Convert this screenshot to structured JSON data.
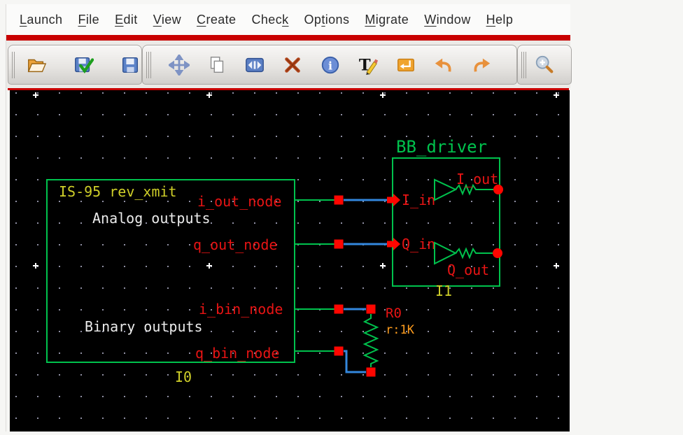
{
  "menubar": {
    "items": [
      {
        "label": "Launch",
        "underline": 0
      },
      {
        "label": "File",
        "underline": 0
      },
      {
        "label": "Edit",
        "underline": 0
      },
      {
        "label": "View",
        "underline": 0
      },
      {
        "label": "Create",
        "underline": 0
      },
      {
        "label": "Check",
        "underline": 4
      },
      {
        "label": "Options",
        "underline": 2
      },
      {
        "label": "Migrate",
        "underline": 0
      },
      {
        "label": "Window",
        "underline": 0
      },
      {
        "label": "Help",
        "underline": 0
      }
    ]
  },
  "toolbar": {
    "groups": [
      {
        "icons": [
          "open-folder",
          "save-check",
          "save"
        ]
      },
      {
        "icons": [
          "move",
          "copy",
          "stretch",
          "delete",
          "properties",
          "edit-text",
          "instance",
          "undo",
          "redo"
        ]
      },
      {
        "icons": [
          "zoom-in"
        ]
      }
    ]
  },
  "schematic": {
    "is95": {
      "title": "IS-95 rev_xmit",
      "note_analog": "Analog outputs",
      "note_binary": "Binary outputs",
      "pin_i_out": "i_out_node",
      "pin_q_out": "q_out_node",
      "pin_i_bin": "i_bin_node",
      "pin_q_bin": "q_bin_node",
      "instance_name": "I0"
    },
    "bb_driver": {
      "title": "BB_driver",
      "pin_i_in": "I_in",
      "pin_q_in": "Q_in",
      "pin_i_out": "I_out",
      "pin_q_out": "Q_out",
      "instance_name": "I1"
    },
    "resistor": {
      "name": "R0",
      "value": "r:1K"
    }
  },
  "colors": {
    "accent_red": "#c90101",
    "sch_green": "#00c24d",
    "sch_blue": "#3387dd",
    "sch_red": "#e81414",
    "sch_bright_red": "#ff0600",
    "sch_yellow": "#cfcf29",
    "sch_orange": "#ff9d1e",
    "sch_white": "#ececec",
    "grid_dot": "#8f8fa3",
    "canvas_bg": "#000000"
  }
}
